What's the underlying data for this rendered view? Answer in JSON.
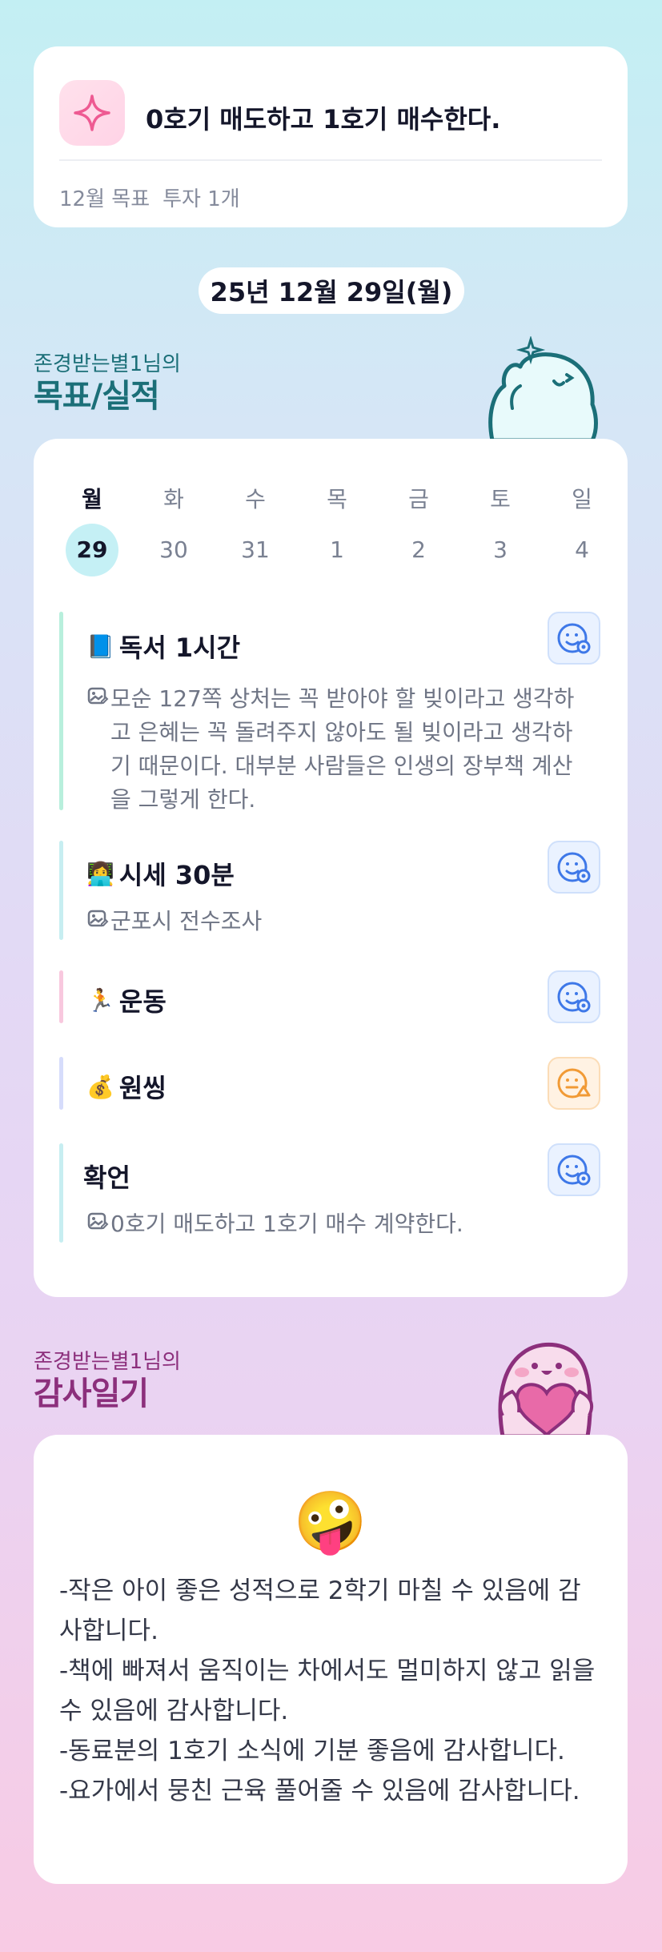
{
  "goal": {
    "title": "0호기 매도하고 1호기 매수한다.",
    "month_label": "12월 목표",
    "count_label": "투자 1개",
    "icon": "sparkle-icon"
  },
  "date": "25년 12월 29일(월)",
  "goal_section": {
    "subtitle": "존경받는별1님의",
    "title": "목표/실적"
  },
  "week": [
    {
      "day": "월",
      "date": "29",
      "today": true
    },
    {
      "day": "화",
      "date": "30"
    },
    {
      "day": "수",
      "date": "31"
    },
    {
      "day": "목",
      "date": "1"
    },
    {
      "day": "금",
      "date": "2"
    },
    {
      "day": "토",
      "date": "3"
    },
    {
      "day": "일",
      "date": "4"
    }
  ],
  "goals": [
    {
      "emoji": "📘",
      "title": "독서 1시간",
      "bar_color": "#b8efdc",
      "status": "smile-blue-icon",
      "note": "모순 127쪽 상처는 꼭 받아야 할 빚이라고 생각하고 은혜는 꼭 돌려주지 않아도 될 빚이라고 생각하기 때문이다. 대부분 사람들은 인생의 장부책 계산을 그렇게 한다."
    },
    {
      "emoji": "👩‍💻",
      "title": "시세 30분",
      "bar_color": "#c7eef1",
      "status": "smile-blue-icon",
      "note": "군포시 전수조사"
    },
    {
      "emoji": "🏃",
      "title": "운동",
      "bar_color": "#f8c8de",
      "status": "smile-blue-icon",
      "note": ""
    },
    {
      "emoji": "💰",
      "title": "원씽",
      "bar_color": "#d6dcfb",
      "status": "smile-orange-icon",
      "note": ""
    },
    {
      "emoji": "",
      "title": "확언",
      "bar_color": "#c7eef1",
      "status": "smile-blue-icon",
      "note": "0호기 매도하고 1호기 매수 계약한다."
    }
  ],
  "gratitude_section": {
    "subtitle": "존경받는별1님의",
    "title": "감사일기"
  },
  "gratitude": {
    "emoji": "🤪",
    "text": "-작은 아이 좋은 성적으로 2학기 마칠 수 있음에 감사합니다.\n-책에 빠져서 움직이는 차에서도 멀미하지 않고 읽을 수 있음에 감사합니다.\n-동료분의 1호기 소식에 기분 좋음에 감사합니다.\n-요가에서 뭉친 근육 풀어줄 수 있음에 감사합니다."
  },
  "colors": {
    "teal_title": "#1b6f78",
    "purple_title": "#8c2f7c",
    "accent_blue": "#3e78e8",
    "accent_orange": "#f19a35"
  }
}
